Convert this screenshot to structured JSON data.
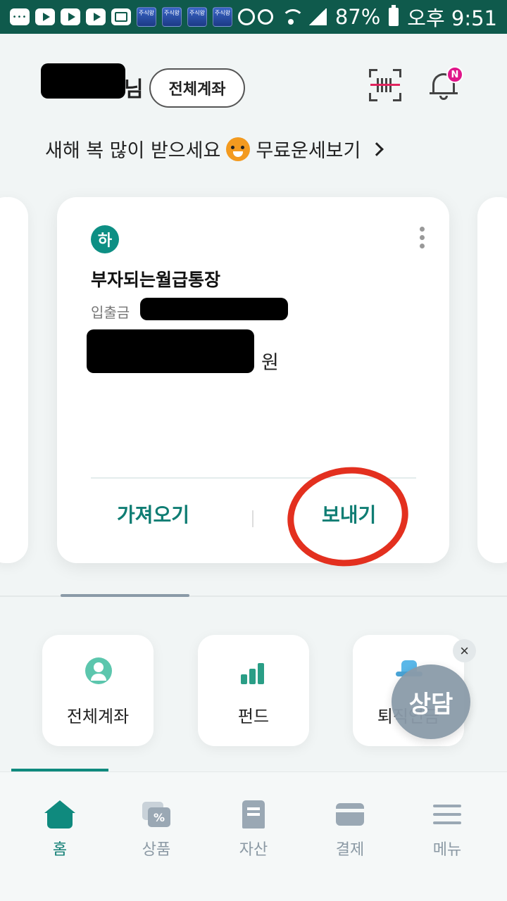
{
  "status_bar": {
    "app_badge_label": "주식왕",
    "battery": "87%",
    "time": "오후 9:51"
  },
  "header": {
    "user_suffix": "님",
    "all_accounts_pill": "전체계좌",
    "notification_badge": "N"
  },
  "banner": {
    "text_before": "새해 복 많이 받으세요",
    "text_after": "무료운세보기"
  },
  "account_card": {
    "bank_logo_glyph": "하",
    "name": "부자되는월급통장",
    "type": "입출금",
    "currency": "원",
    "fetch_button": "가져오기",
    "send_button": "보내기"
  },
  "quick_tiles": [
    {
      "label": "전체계좌",
      "icon": "person-icon"
    },
    {
      "label": "펀드",
      "icon": "fund-chart-icon"
    },
    {
      "label": "퇴직연금",
      "icon": "hat-icon"
    }
  ],
  "floating": {
    "close_glyph": "×",
    "chat_label": "상담"
  },
  "bottom_nav": [
    {
      "label": "홈",
      "icon": "home-icon",
      "active": true
    },
    {
      "label": "상품",
      "icon": "product-icon",
      "active": false
    },
    {
      "label": "자산",
      "icon": "asset-icon",
      "active": false
    },
    {
      "label": "결제",
      "icon": "card-icon",
      "active": false
    },
    {
      "label": "메뉴",
      "icon": "menu-icon",
      "active": false
    }
  ],
  "colors": {
    "status_bar": "#0f5a4c",
    "accent": "#0f7d73",
    "annotation_red": "#e3301f",
    "badge_pink": "#e0168a"
  }
}
